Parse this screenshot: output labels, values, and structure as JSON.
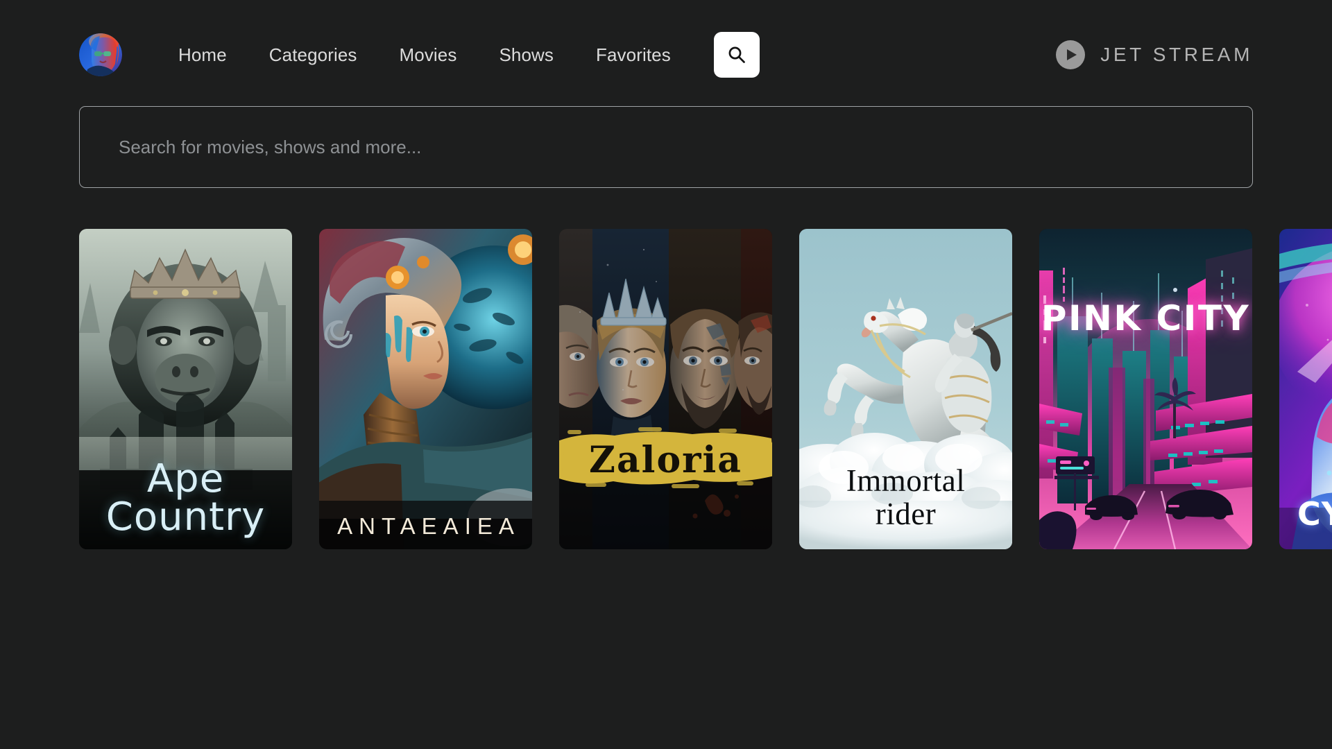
{
  "theme": {
    "background": "#1d1e1e",
    "text_primary": "#e8e8e8",
    "text_muted": "#8e9194",
    "accent_white": "#ffffff",
    "brand_gray": "#b4b4b4"
  },
  "header": {
    "avatar_icon": "user-avatar-portrait",
    "nav": [
      {
        "label": "Home"
      },
      {
        "label": "Categories"
      },
      {
        "label": "Movies"
      },
      {
        "label": "Shows"
      },
      {
        "label": "Favorites"
      }
    ],
    "search_toggle": {
      "icon": "search-icon"
    },
    "brand": {
      "icon": "play-circle-icon",
      "wordmark": "JET STREAM"
    }
  },
  "search": {
    "value": "",
    "placeholder": "Search for movies, shows and more..."
  },
  "rail": {
    "posters": [
      {
        "title": "Ape Country",
        "title_lines": [
          "Ape",
          "Country"
        ],
        "artwork": "crowned-gorilla-ruined-city",
        "palette": {
          "primary": "#8d9b94",
          "title": "#d9eff6"
        }
      },
      {
        "title": "ANTAEAIEA",
        "title_lines": [
          "ANTAEAIEA"
        ],
        "artwork": "sci-fi-woman-ornate-headdress",
        "palette": {
          "primary": "#2b7f92",
          "title": "#f3ead9"
        }
      },
      {
        "title": "Zaloria",
        "title_lines": [
          "Zaloria"
        ],
        "artwork": "four-character-portrait-panels",
        "palette": {
          "primary": "#d4b53c",
          "title": "#131008"
        }
      },
      {
        "title": "Immortal rider",
        "title_lines": [
          "Immortal",
          "rider"
        ],
        "artwork": "white-horse-rider-above-clouds",
        "palette": {
          "primary": "#9cc3cc",
          "title": "#0c0f11"
        }
      },
      {
        "title": "PINK CITY",
        "title_lines": [
          "PINK CITY"
        ],
        "artwork": "neon-cyberpunk-cityscape",
        "palette": {
          "primary": "#ff4fd8",
          "title": "#ffffff"
        }
      },
      {
        "title": "CY",
        "title_lines": [
          "CY"
        ],
        "artwork": "neon-portrait-vivid-pink-blue",
        "palette": {
          "primary": "#e43cd8",
          "title": "#ffffff"
        }
      }
    ]
  }
}
